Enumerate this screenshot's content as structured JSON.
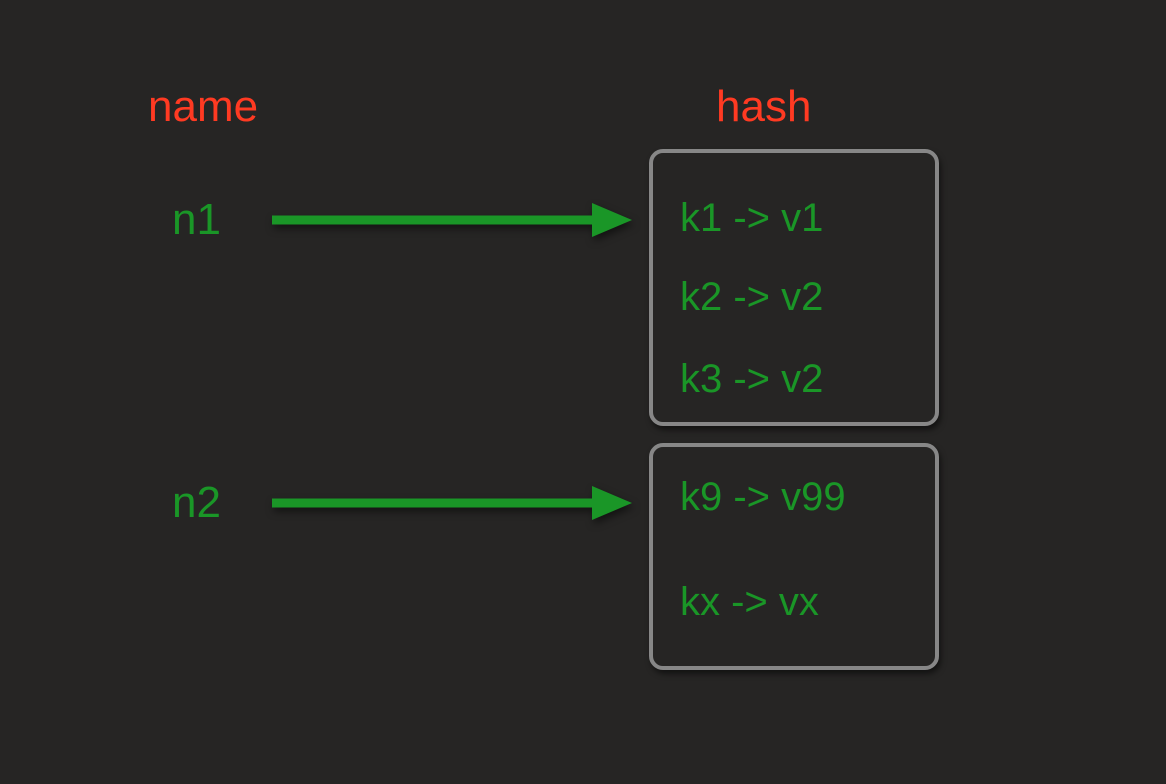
{
  "headers": {
    "name": "name",
    "hash": "hash"
  },
  "names": {
    "n1": "n1",
    "n2": "n2"
  },
  "hash1": {
    "entry1": "k1 -> v1",
    "entry2": "k2 -> v2",
    "entry3": "k3 -> v2"
  },
  "hash2": {
    "entry1": "k9 -> v99",
    "entry2": "kx -> vx"
  },
  "colors": {
    "background": "#262524",
    "header": "#ff3a22",
    "text": "#1a9627",
    "border": "#878787",
    "arrow": "#1a9627"
  }
}
